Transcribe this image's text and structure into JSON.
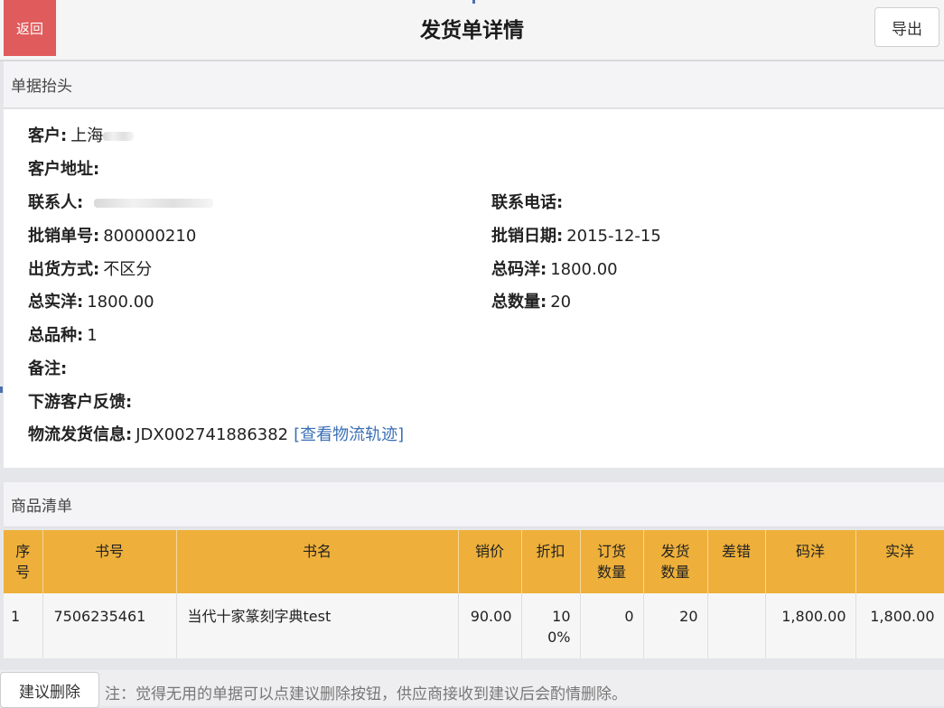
{
  "header": {
    "back_label": "返回",
    "title": "发货单详情",
    "export_label": "导出"
  },
  "sections": {
    "header_title": "单据抬头",
    "items_title": "商品清单"
  },
  "order": {
    "customer_label": "客户:",
    "customer_value": "上海",
    "address_label": "客户地址:",
    "address_value": "",
    "contact_label": "联系人:",
    "phone_label": "联系电话:",
    "phone_value": "",
    "order_no_label": "批销单号:",
    "order_no_value": "800000210",
    "date_label": "批销日期:",
    "date_value": "2015-12-15",
    "ship_method_label": "出货方式:",
    "ship_method_value": "不区分",
    "total_list_label": "总码洋:",
    "total_list_value": "1800.00",
    "total_net_label": "总实洋:",
    "total_net_value": "1800.00",
    "total_qty_label": "总数量:",
    "total_qty_value": "20",
    "total_kinds_label": "总品种:",
    "total_kinds_value": "1",
    "remark_label": "备注:",
    "remark_value": "",
    "feedback_label": "下游客户反馈:",
    "feedback_value": "",
    "logistics_label": "物流发货信息:",
    "logistics_value": "JDX002741886382",
    "logistics_link": "[查看物流轨迹]"
  },
  "table": {
    "headers": [
      "序号",
      "书号",
      "书名",
      "销价",
      "折扣",
      "订货数量",
      "发货数量",
      "差错",
      "码洋",
      "实洋"
    ],
    "rows": [
      {
        "seq": "1",
        "isbn": "7506235461",
        "name": "当代十家篆刻字典test",
        "price": "90.00",
        "discount": "100%",
        "ordered": "0",
        "shipped": "20",
        "error": "",
        "list_amount": "1,800.00",
        "net_amount": "1,800.00"
      }
    ]
  },
  "footer": {
    "suggest_delete_label": "建议删除",
    "note": "注：觉得无用的单据可以点建议删除按钮，供应商接收到建议后会酌情删除。"
  },
  "colors": {
    "back_button": "#e05b5c",
    "table_header": "#eeb03a",
    "link": "#3a6fb5"
  }
}
